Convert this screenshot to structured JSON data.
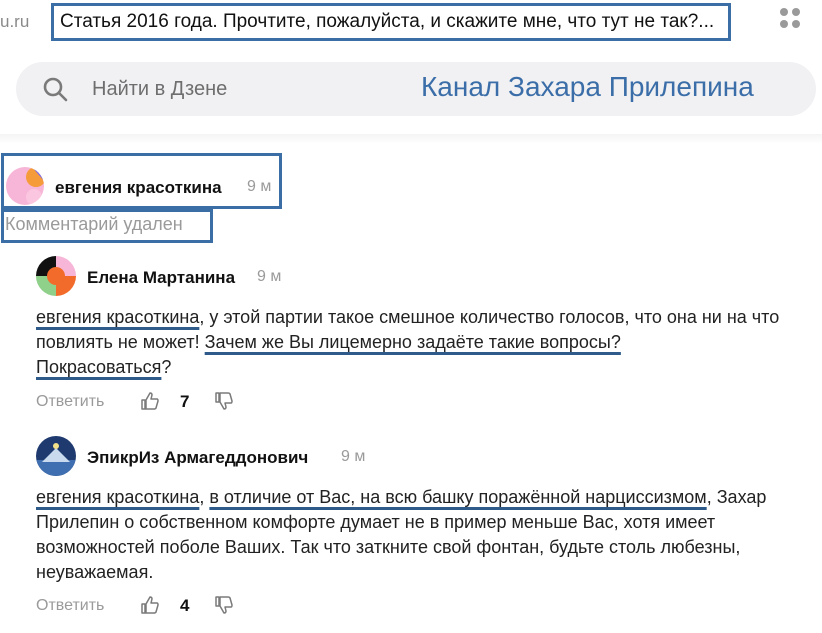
{
  "browser": {
    "domain_tail": "u.ru",
    "tab_title": "Статья 2016 года. Прочтите, пожалуйста, и скажите мне, что тут не так?..."
  },
  "search": {
    "placeholder": "Найти в Дзене"
  },
  "channel_title": "Канал Захара Прилепина",
  "comments": {
    "root": {
      "author": "евгения красоткина",
      "time": "9 м",
      "deleted_text": "Комментарий удален"
    },
    "reply1": {
      "author": "Елена Мартанина",
      "time": "9 м",
      "mention": "евгения красоткина",
      "text_part1": ", у этой партии такое смешное количество голосов, что она ни на что повлиять не может! ",
      "text_ul1": "Зачем же Вы лицемерно задаёте такие вопросы?",
      "text_ul2": "Покрасоваться",
      "text_end": "?",
      "reply_label": "Ответить",
      "likes": "7"
    },
    "reply2": {
      "author": "ЭпикрИз Армагеддонович",
      "time": "9 м",
      "mention": "евгения красоткина",
      "text_comma": ", ",
      "text_ul": "в отличие от Вас, на всю башку поражённой нарциссизмом",
      "text_rest": ", Захар Прилепин о собственном комфорте думает не в пример меньше Вас, хотя имеет возможностей поболе Ваших. Так что заткните свой фонтан, будьте столь любезны, неуважаемая.",
      "reply_label": "Ответить",
      "likes": "4"
    }
  },
  "colors": {
    "highlight_box": "#3a6ea5",
    "channel_title": "#3b6ea8",
    "muted": "#9a9a9a",
    "search_bg": "#f1f1f3"
  },
  "icons": [
    "apps-icon",
    "search-icon",
    "like-icon",
    "dislike-icon"
  ]
}
